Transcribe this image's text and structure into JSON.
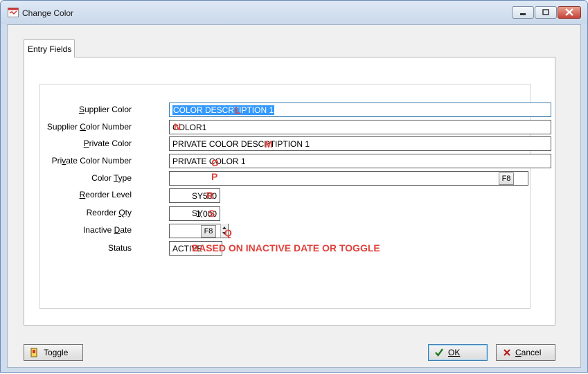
{
  "window": {
    "title": "Change Color"
  },
  "tabs": [
    {
      "label": "Entry Fields"
    }
  ],
  "form": {
    "supplier_color": {
      "label": "Supplier Color",
      "value": "COLOR DESCRTIPTION 1",
      "tag": "L"
    },
    "supplier_color_number": {
      "label": "Supplier Color Number",
      "value": "COLOR1",
      "tag": "N"
    },
    "private_color": {
      "label": "Private Color",
      "value": "PRIVATE COLOR DESCRTIPTION 1",
      "tag": "M"
    },
    "private_color_number": {
      "label": "Private Color Number",
      "value": "PRIVATE COLOR 1",
      "tag": "O"
    },
    "color_type": {
      "label": "Color Type",
      "value": "",
      "tag": "P",
      "lookup": "F8"
    },
    "reorder_level": {
      "label": "Reorder Level",
      "value": "500",
      "unit": "SY",
      "tag": "R"
    },
    "reorder_qty": {
      "label": "Reorder Qty",
      "value": "1,000",
      "unit": "SY",
      "tag": "S"
    },
    "inactive_date": {
      "label": "Inactive Date",
      "value": "",
      "lookup": "F8",
      "tag": "Q"
    },
    "status": {
      "label": "Status",
      "value": "ACTIVE",
      "note": "BASED ON INACTIVE DATE OR TOGGLE"
    }
  },
  "buttons": {
    "toggle": "Toggle",
    "ok": "OK",
    "cancel": "Cancel"
  },
  "icons": {
    "app": "app-icon",
    "toggle": "toggle-icon",
    "ok": "checkmark-icon",
    "cancel": "x-icon"
  },
  "colors": {
    "annotation": "#e0403a",
    "selection": "#3399ff",
    "accent": "#3c7fb1"
  }
}
